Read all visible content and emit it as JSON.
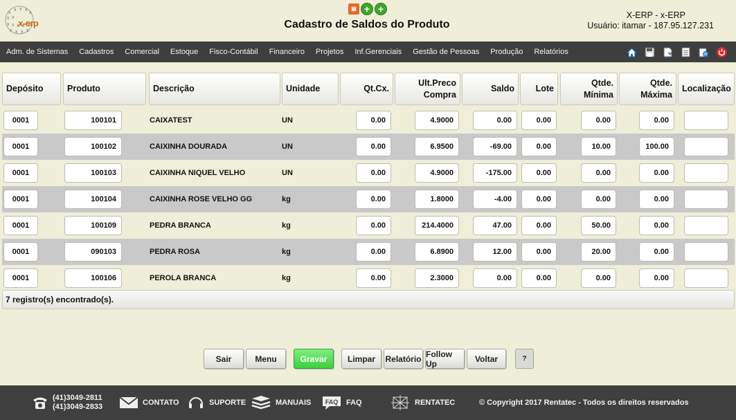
{
  "header": {
    "title": "Cadastro de Saldos do Produto",
    "system": "X-ERP - x-ERP",
    "user_line": "Usuário: itamar - 187.95.127.231",
    "logo_text": "x-erp",
    "icons": [
      "document-icon",
      "add-icon",
      "add-icon"
    ]
  },
  "menu": {
    "items": [
      "Adm. de Sistemas",
      "Cadastros",
      "Comercial",
      "Estoque",
      "Fisco-Contábil",
      "Financeiro",
      "Projetos",
      "Inf.Gerenciais",
      "Gestão de Pessoas",
      "Produção",
      "Relatórios"
    ],
    "icons": [
      "home-icon",
      "save-icon",
      "document-icon",
      "list-icon",
      "search-icon",
      "power-icon"
    ]
  },
  "table": {
    "columns": {
      "deposito": "Depósito",
      "produto": "Produto",
      "descricao": "Descrição",
      "unidade": "Unidade",
      "qtcx": "Qt.Cx.",
      "ultpreco_1": "Ult.Preco",
      "ultpreco_2": "Compra",
      "saldo": "Saldo",
      "lote": "Lote",
      "qtmin_1": "Qtde.",
      "qtmin_2": "Mínima",
      "qtmax_1": "Qtde.",
      "qtmax_2": "Máxima",
      "localizacao": "Localização"
    },
    "rows": [
      {
        "deposito": "0001",
        "produto": "100101",
        "descricao": "CAIXATEST",
        "unidade": "UN",
        "qtcx": "0.00",
        "preco": "4.9000",
        "saldo": "0.00",
        "lote": "0.00",
        "min": "0.00",
        "max": "0.00",
        "loc": ""
      },
      {
        "deposito": "0001",
        "produto": "100102",
        "descricao": "CAIXINHA DOURADA",
        "unidade": "UN",
        "qtcx": "0.00",
        "preco": "6.9500",
        "saldo": "-69.00",
        "lote": "0.00",
        "min": "10.00",
        "max": "100.00",
        "loc": ""
      },
      {
        "deposito": "0001",
        "produto": "100103",
        "descricao": "CAIXINHA NIQUEL VELHO",
        "unidade": "UN",
        "qtcx": "0.00",
        "preco": "4.9000",
        "saldo": "-175.00",
        "lote": "0.00",
        "min": "0.00",
        "max": "0.00",
        "loc": ""
      },
      {
        "deposito": "0001",
        "produto": "100104",
        "descricao": "CAIXINHA ROSE VELHO GG",
        "unidade": "kg",
        "qtcx": "0.00",
        "preco": "1.8000",
        "saldo": "-4.00",
        "lote": "0.00",
        "min": "0.00",
        "max": "0.00",
        "loc": ""
      },
      {
        "deposito": "0001",
        "produto": "100109",
        "descricao": "PEDRA BRANCA",
        "unidade": "kg",
        "qtcx": "0.00",
        "preco": "214.4000",
        "saldo": "47.00",
        "lote": "0.00",
        "min": "50.00",
        "max": "0.00",
        "loc": ""
      },
      {
        "deposito": "0001",
        "produto": "090103",
        "descricao": "PEDRA ROSA",
        "unidade": "kg",
        "qtcx": "0.00",
        "preco": "6.8900",
        "saldo": "12.00",
        "lote": "0.00",
        "min": "20.00",
        "max": "0.00",
        "loc": ""
      },
      {
        "deposito": "0001",
        "produto": "100106",
        "descricao": "PEROLA BRANCA",
        "unidade": "kg",
        "qtcx": "0.00",
        "preco": "2.3000",
        "saldo": "0.00",
        "lote": "0.00",
        "min": "0.00",
        "max": "0.00",
        "loc": ""
      }
    ],
    "record_count": "7 registro(s) encontrado(s)."
  },
  "buttons": {
    "sair": "Sair",
    "menu": "Menu",
    "gravar": "Gravar",
    "limpar": "Limpar",
    "relatorio": "Relatório",
    "followup": "Follow Up",
    "voltar": "Voltar",
    "help": "?"
  },
  "footer": {
    "phone_1": "(41)3049-2811",
    "phone_2": "(41)3049-2833",
    "contato": "CONTATO",
    "suporte": "SUPORTE",
    "manuais": "MANUAIS",
    "faq": "FAQ",
    "faq_icon_text": "FAQ",
    "rentatec": "RENTATEC",
    "copyright": "© Copyright 2017 Rentatec - Todos os direitos reservados"
  },
  "colors": {
    "background": "#efeed9",
    "menubar": "#3e3e3e",
    "alt_row": "#c9c9c9",
    "gravar_button": "#3dcf3d"
  }
}
